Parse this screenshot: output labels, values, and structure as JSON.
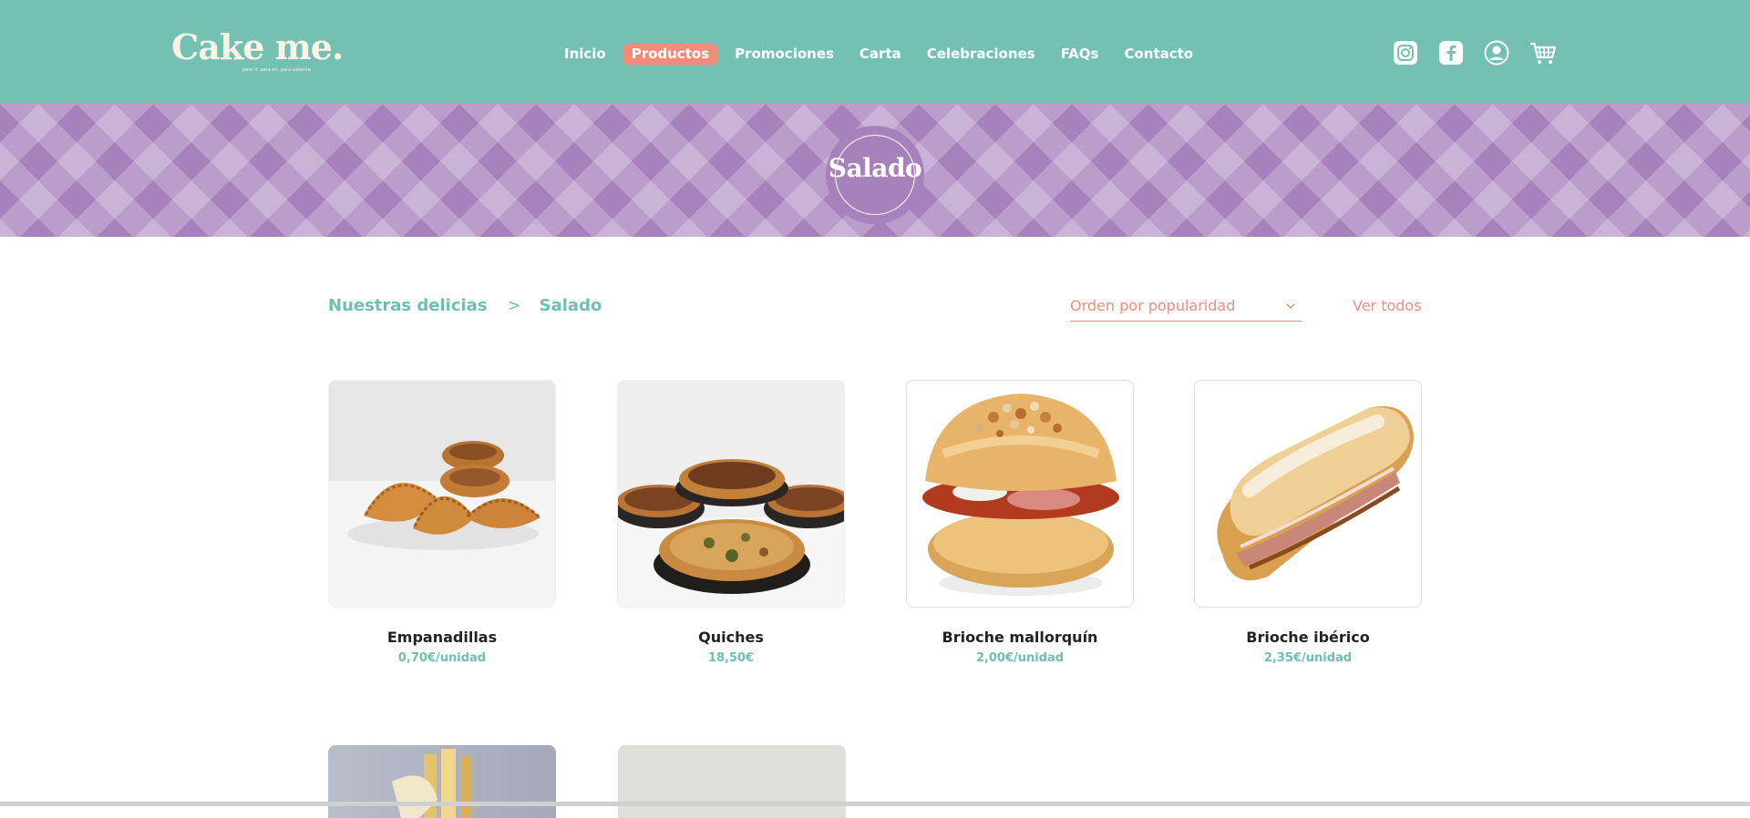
{
  "brand": {
    "name": "Cake me.",
    "tagline": "para ti, para mi, para valiente"
  },
  "nav": {
    "items": [
      {
        "label": "Inicio",
        "active": false
      },
      {
        "label": "Productos",
        "active": true
      },
      {
        "label": "Promociones",
        "active": false
      },
      {
        "label": "Carta",
        "active": false
      },
      {
        "label": "Celebraciones",
        "active": false
      },
      {
        "label": "FAQs",
        "active": false
      },
      {
        "label": "Contacto",
        "active": false
      }
    ]
  },
  "header_icons": [
    "instagram-icon",
    "facebook-icon",
    "user-account-icon",
    "cart-icon"
  ],
  "banner": {
    "title": "Salado"
  },
  "breadcrumb": {
    "root": "Nuestras delicias",
    "separator": ">",
    "current": "Salado"
  },
  "sort": {
    "selected": "Orden por popularidad"
  },
  "view_all": "Ver todos",
  "products": [
    {
      "name": "Empanadillas",
      "price": "0,70€/unidad"
    },
    {
      "name": "Quiches",
      "price": "18,50€"
    },
    {
      "name": "Brioche mallorquín",
      "price": "2,00€/unidad"
    },
    {
      "name": "Brioche ibérico",
      "price": "2,35€/unidad"
    }
  ],
  "colors": {
    "header": "#74c0b3",
    "banner": "#a781bb",
    "accent": "#ef8d7a",
    "teal_text": "#6fbfae",
    "cream": "#fdf3e4"
  }
}
